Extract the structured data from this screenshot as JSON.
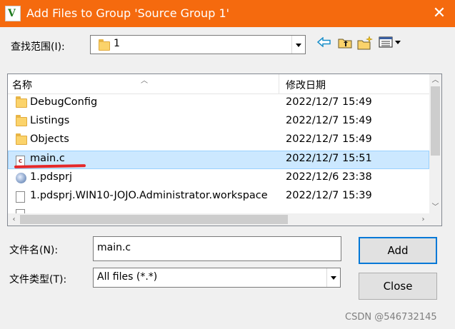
{
  "window": {
    "title": "Add Files to Group 'Source Group 1'",
    "close_glyph": "✕"
  },
  "lookin": {
    "label": "查找范围(I):",
    "value": "1"
  },
  "toolbar": {
    "back_icon": "back-arrow-icon",
    "up_icon": "up-folder-icon",
    "new_icon": "new-folder-icon",
    "view_icon": "view-menu-icon"
  },
  "list": {
    "columns": [
      "名称",
      "修改日期"
    ],
    "rows": [
      {
        "icon": "folder-icon",
        "name": "DebugConfig",
        "date": "2022/12/7 15:49"
      },
      {
        "icon": "folder-icon",
        "name": "Listings",
        "date": "2022/12/7 15:49"
      },
      {
        "icon": "folder-icon",
        "name": "Objects",
        "date": "2022/12/7 15:49"
      },
      {
        "icon": "c-file-icon",
        "name": "main.c",
        "date": "2022/12/7 15:51",
        "selected": true
      },
      {
        "icon": "project-icon",
        "name": "1.pdsprj",
        "date": "2022/12/6 23:38"
      },
      {
        "icon": "file-icon",
        "name": "1.pdsprj.WIN10-JOJO.Administrator.workspace",
        "date": "2022/12/7 15:39"
      }
    ]
  },
  "filename": {
    "label": "文件名(N):",
    "value": "main.c"
  },
  "filetype": {
    "label": "文件类型(T):",
    "value": "All files (*.*)"
  },
  "buttons": {
    "add": "Add",
    "close": "Close"
  },
  "watermark": "CSDN @546732145",
  "colors": {
    "titlebar": "#f56a0e",
    "selection": "#cce8ff",
    "annotation": "#e5282a"
  }
}
